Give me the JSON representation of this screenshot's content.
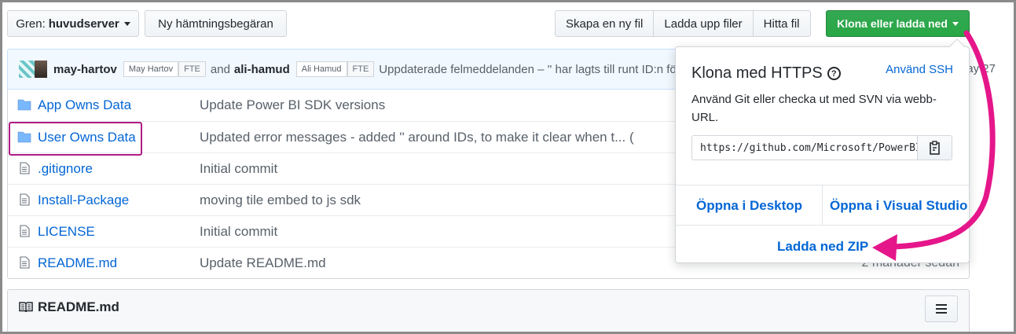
{
  "toolbar": {
    "branch_prefix": "Gren:",
    "branch_name": "huvudserver",
    "new_pull_request": "Ny hämtningsbegäran",
    "create_file": "Skapa en ny fil",
    "upload_files": "Ladda upp filer",
    "find_file": "Hitta fil",
    "clone_download": "Klona eller ladda ned"
  },
  "commit": {
    "user1": "may-hartov",
    "user1_name": "May Hartov",
    "tag1": "FTE",
    "conjunction": "and",
    "user2": "ali-hamud",
    "user2_name": "Ali Hamud",
    "tag2": "FTE",
    "message": "Uppdaterade felmeddelanden – '' har lagts till runt ID:n fö",
    "date_fragment": "ay 27"
  },
  "files": [
    {
      "name": "App Owns Data",
      "type": "folder",
      "message": "Update Power BI SDK versions",
      "age": ""
    },
    {
      "name": "User Owns Data",
      "type": "folder",
      "message": "Updated error messages - added '' around IDs, to make it clear when t... (",
      "age": ""
    },
    {
      "name": ".gitignore",
      "type": "file",
      "message": "Initial commit",
      "age": ""
    },
    {
      "name": "Install-Package",
      "type": "file",
      "message": "moving tile embed to js sdk",
      "age": ""
    },
    {
      "name": "LICENSE",
      "type": "file",
      "message": "Initial commit",
      "age": ""
    },
    {
      "name": "README.md",
      "type": "file",
      "message": "Update README.md",
      "age": "2 månader sedan"
    }
  ],
  "readme": {
    "title": "README.md"
  },
  "clone_panel": {
    "title": "Klona med HTTPS",
    "help_glyph": "?",
    "use_ssh": "Använd SSH",
    "description": "Använd Git eller checka ut med SVN via webb-URL.",
    "url": "https://github.com/Microsoft/PowerBI-Developer-Samples.git",
    "open_desktop": "Öppna i Desktop",
    "open_visual_studio": "Öppna i Visual Studio",
    "download_zip": "Ladda ned ZIP"
  },
  "colors": {
    "accent_green": "#28a745",
    "link_blue": "#0366d6",
    "annotation_magenta": "#e5168a",
    "highlight_border": "#b01c84"
  }
}
